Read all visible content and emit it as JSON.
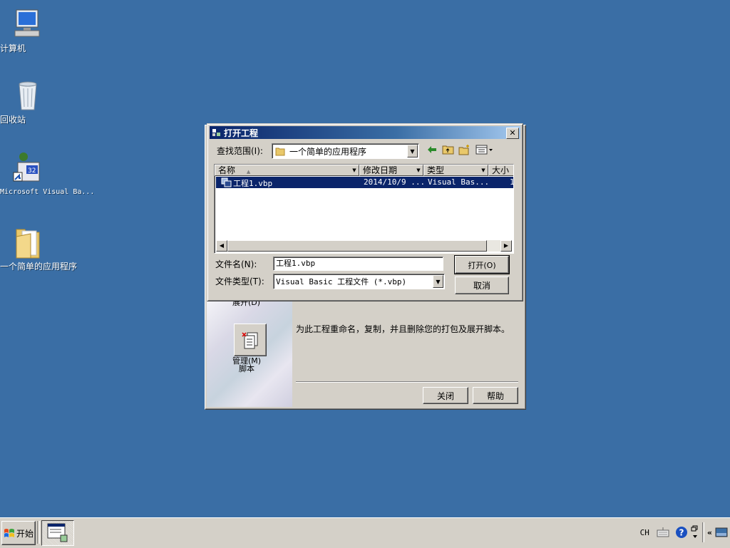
{
  "desktop": {
    "icons": [
      {
        "label": "计算机"
      },
      {
        "label": "回收站"
      },
      {
        "label": "Microsoft Visual Ba..."
      },
      {
        "label": "一个简单的应用程序"
      }
    ]
  },
  "back_dialog": {
    "partial_label": "展开(D)",
    "manage_label": "管理(M)\n脚本",
    "description": "为此工程重命名，复制，并且删除您的打包及展开脚本。",
    "close_label": "关闭",
    "help_label": "帮助"
  },
  "dialog": {
    "title": "打开工程",
    "look_in_label": "查找范围(I):",
    "look_in_value": "一个简单的应用程序",
    "columns": [
      "名称",
      "修改日期",
      "类型",
      "大小"
    ],
    "rows": [
      {
        "name": "工程1.vbp",
        "date": "2014/10/9 ...",
        "type": "Visual Bas...",
        "size": "1"
      }
    ],
    "filename_label": "文件名(N):",
    "filename_value": "工程1.vbp",
    "filetype_label": "文件类型(T):",
    "filetype_value": "Visual Basic 工程文件 (*.vbp)",
    "open_label": "打开(O)",
    "cancel_label": "取消"
  },
  "taskbar": {
    "start_label": "开始",
    "ime": "CH"
  },
  "colors": {
    "desktop": "#3a6ea5",
    "face": "#d4d0c8",
    "selection": "#0a246a"
  }
}
